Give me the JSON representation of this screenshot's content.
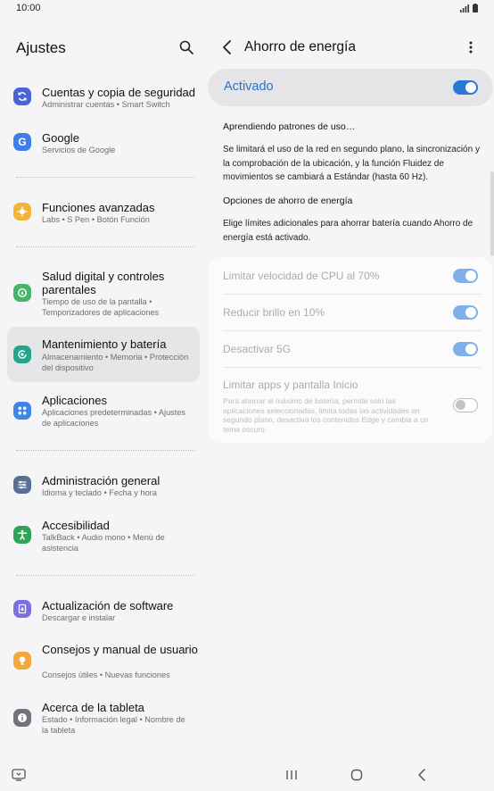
{
  "status": {
    "time": "10:00"
  },
  "settings": {
    "title": "Ajustes",
    "items": [
      {
        "title": "Cuentas y copia de seguridad",
        "sub": "Administrar cuentas  •  Smart Switch",
        "icon": "accounts-sync-icon",
        "color": "#4a63d8"
      },
      {
        "title": "Google",
        "sub": "Servicios de Google",
        "icon": "google-icon",
        "color": "#3d7ee8"
      },
      {
        "title": "Funciones avanzadas",
        "sub": "Labs  •  S Pen  •  Botón Función",
        "icon": "advanced-features-icon",
        "color": "#f2b43c"
      },
      {
        "title": "Salud digital y controles parentales",
        "sub": "Tiempo de uso de la pantalla  •  Temporizadores de aplicaciones",
        "icon": "digital-wellbeing-icon",
        "color": "#46b56a"
      },
      {
        "title": "Mantenimiento y batería",
        "sub": "Almacenamiento  •  Memoria  •  Protección del dispositivo",
        "icon": "device-care-icon",
        "color": "#22a58b"
      },
      {
        "title": "Aplicaciones",
        "sub": "Aplicaciones predeterminadas  •  Ajustes de aplicaciones",
        "icon": "apps-icon",
        "color": "#3d86e6"
      },
      {
        "title": "Administración general",
        "sub": "Idioma y teclado  •  Fecha y hora",
        "icon": "general-management-icon",
        "color": "#5a6f93"
      },
      {
        "title": "Accesibilidad",
        "sub": "TalkBack  •  Audio mono  •  Menú de asistencia",
        "icon": "accessibility-icon",
        "color": "#2ea35a"
      },
      {
        "title": "Actualización de software",
        "sub": "Descargar e instalar",
        "icon": "software-update-icon",
        "color": "#7c6fe0"
      },
      {
        "title": "Consejos y manual de usuario",
        "sub": "Consejos útiles  •  Nuevas funciones",
        "icon": "tips-icon",
        "color": "#f2a83a"
      },
      {
        "title": "Acerca de la tableta",
        "sub": "Estado  •  Información legal  •  Nombre de la tableta",
        "icon": "about-info-icon",
        "color": "#70737a"
      }
    ]
  },
  "power_saving": {
    "title": "Ahorro de energía",
    "master_label": "Activado",
    "master_on": true,
    "learning_heading": "Aprendiendo patrones de uso…",
    "learning_text": "Se limitará el uso de la red en segundo plano, la sincronización y la comprobación de la ubicación, y la función Fluidez de movimientos se cambiará a Estándar (hasta 60 Hz).",
    "options_heading": "Opciones de ahorro de energía",
    "options_text": "Elige límites adicionales para ahorrar batería cuando Ahorro de energía está activado.",
    "options": [
      {
        "title": "Limitar velocidad de CPU al 70%",
        "on": true
      },
      {
        "title": "Reducir brillo en 10%",
        "on": true
      },
      {
        "title": "Desactivar 5G",
        "on": true
      },
      {
        "title": "Limitar apps y pantalla Inicio",
        "desc": "Para ahorrar el máximo de batería, permite solo las aplicaciones seleccionadas, limita todas las actividades en segundo plano, desactiva los contenidos Edge y cambia a un tema oscuro.",
        "on": false
      }
    ]
  },
  "colors": {
    "accent": "#2a78d6",
    "selected_bg": "#e6e6e8"
  }
}
